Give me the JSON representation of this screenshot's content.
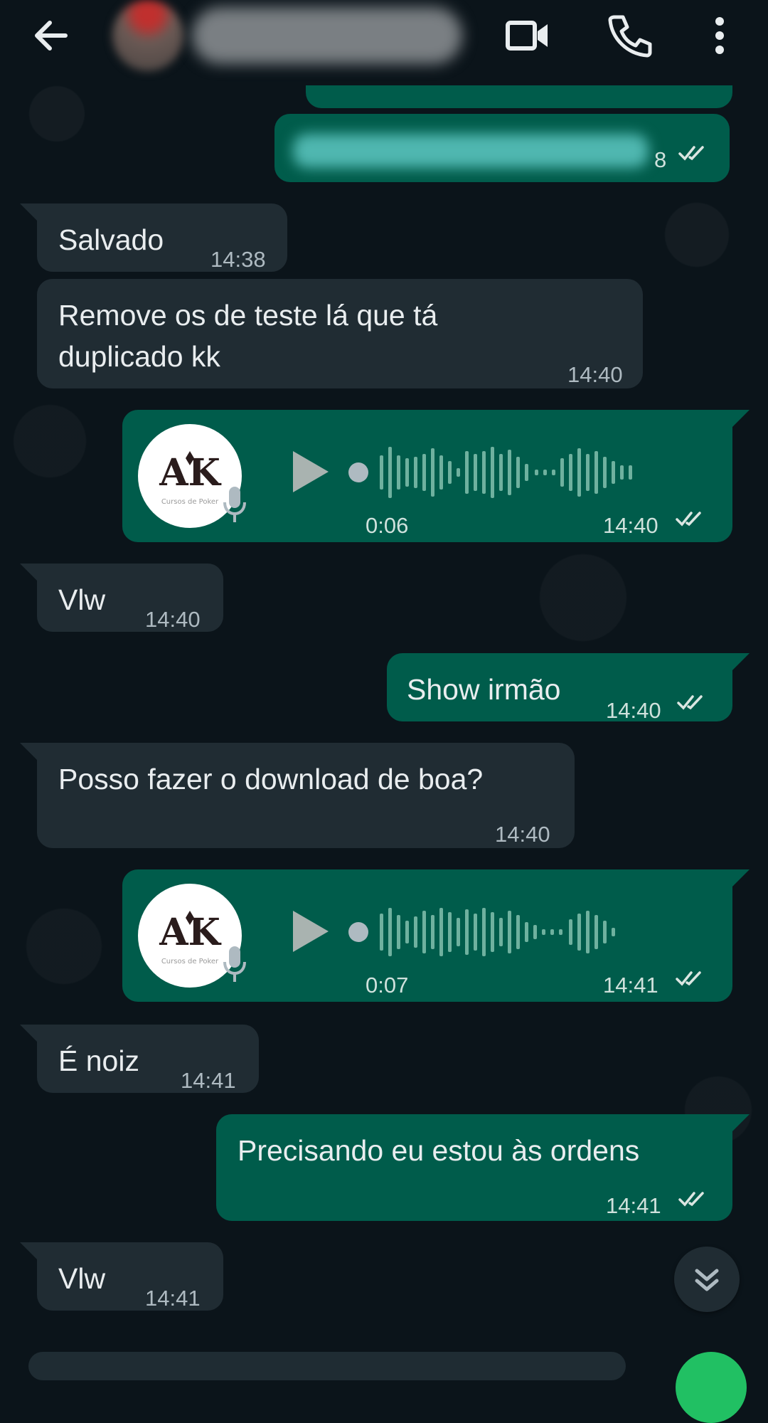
{
  "header": {
    "back_icon": "arrow-left-icon",
    "video_icon": "video-camera-icon",
    "call_icon": "phone-icon",
    "menu_icon": "more-vertical-icon"
  },
  "colors": {
    "background": "#0b141a",
    "incoming_bubble": "#202c33",
    "outgoing_bubble": "#005c4b",
    "timestamp": "#aebac1",
    "read_ticks": "#dbe6e2"
  },
  "messages": [
    {
      "direction": "out",
      "text": "",
      "time": "14:38",
      "ticks": "read",
      "visible_time_fragment": "8"
    },
    {
      "direction": "in",
      "text": "Salvado",
      "time": "14:38"
    },
    {
      "direction": "in",
      "text_lines": [
        "Remove os de teste lá que tá",
        "duplicado kk"
      ],
      "time": "14:40"
    },
    {
      "direction": "out",
      "type": "voice",
      "duration": "0:06",
      "time": "14:40",
      "ticks": "read",
      "avatar_icon": "ak-logo-icon"
    },
    {
      "direction": "in",
      "text": "Vlw",
      "time": "14:40"
    },
    {
      "direction": "out",
      "text": "Show irmão",
      "time": "14:40",
      "ticks": "read"
    },
    {
      "direction": "in",
      "text": "Posso fazer o download de boa?",
      "time": "14:40"
    },
    {
      "direction": "out",
      "type": "voice",
      "duration": "0:07",
      "time": "14:41",
      "ticks": "read",
      "avatar_icon": "ak-logo-icon"
    },
    {
      "direction": "in",
      "text": "É noiz",
      "time": "14:41"
    },
    {
      "direction": "out",
      "text": "Precisando eu estou às ordens",
      "time": "14:41",
      "ticks": "read"
    },
    {
      "direction": "in",
      "text": "Vlw",
      "time": "14:41"
    }
  ],
  "scroll_down_icon": "double-chevron-down-icon"
}
